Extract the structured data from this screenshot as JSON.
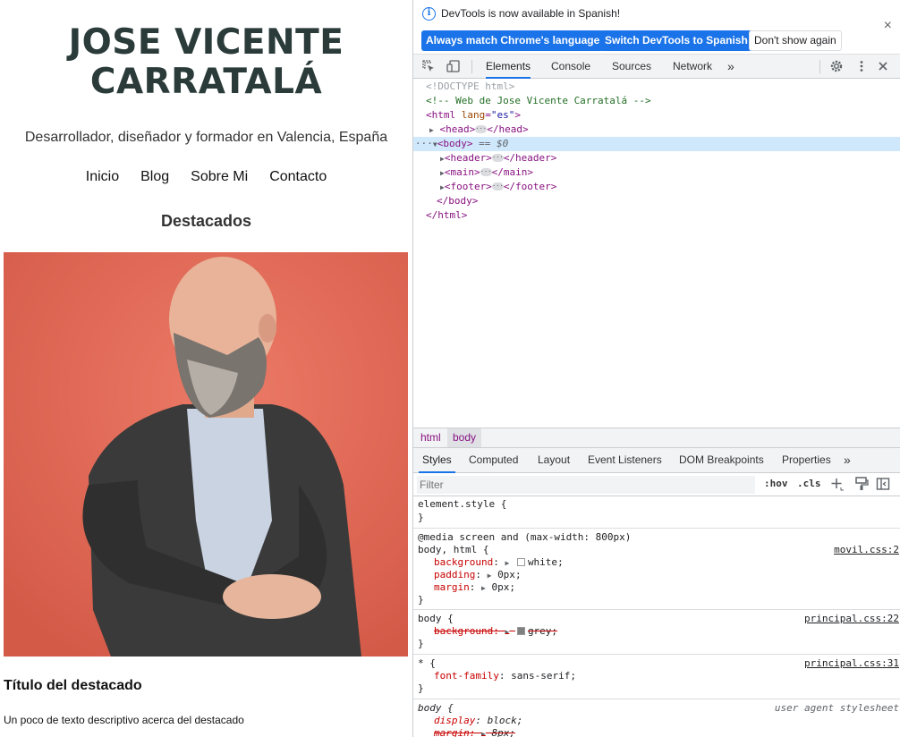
{
  "site": {
    "title_line1": "Jose Vicente",
    "title_line2": "Carratalá",
    "tagline": "Desarrollador, diseñador y formador en Valencia, España",
    "nav": [
      "Inicio",
      "Blog",
      "Sobre Mi",
      "Contacto"
    ],
    "featured_heading": "Destacados",
    "featured_title": "Título del destacado",
    "featured_text": "Un poco de texto descriptivo acerca del destacado"
  },
  "devtools": {
    "infobar": {
      "message": "DevTools is now available in Spanish!",
      "btn_match": "Always match Chrome's language",
      "btn_switch": "Switch DevTools to Spanish",
      "btn_dismiss": "Don't show again",
      "close_icon": "×"
    },
    "tabs": [
      "Elements",
      "Console",
      "Sources",
      "Network"
    ],
    "more_tabs": "»",
    "dom": {
      "doctype": "<!DOCTYPE html>",
      "comment": "<!-- Web de Jose Vicente Carratalá -->",
      "html_open_tag": "<html",
      "html_attr": "lang",
      "html_attr_value": "\"es\"",
      "html_close_bracket": ">",
      "head_open": "<head>",
      "head_close": "</head>",
      "body_open": "<body>",
      "selected_marker": "== $0",
      "header_open": "<header>",
      "header_close": "</header>",
      "main_open": "<main>",
      "main_close": "</main>",
      "footer_open": "<footer>",
      "footer_close": "</footer>",
      "body_close": "</body>",
      "html_close": "</html>"
    },
    "breadcrumbs": [
      "html",
      "body"
    ],
    "subtabs": [
      "Styles",
      "Computed",
      "Layout",
      "Event Listeners",
      "DOM Breakpoints",
      "Properties"
    ],
    "filter_placeholder": "Filter",
    "hov": ":hov",
    "cls": ".cls",
    "styles": {
      "element_style": "element.style {",
      "close": "}",
      "media": "@media screen and (max-width: 800px)",
      "rule1_selector": "body, html {",
      "rule1_source": "movil.css:2",
      "rule1_props": [
        {
          "name": "background",
          "value": "white",
          "swatch": "#ffffff"
        },
        {
          "name": "padding",
          "value": "0px"
        },
        {
          "name": "margin",
          "value": "0px"
        }
      ],
      "rule2_selector": "body {",
      "rule2_source": "principal.css:22",
      "rule2_prop_name": "background",
      "rule2_prop_value": "grey;",
      "rule2_swatch": "#808080",
      "rule3_selector": "* {",
      "rule3_source": "principal.css:31",
      "rule3_prop_name": "font-family",
      "rule3_prop_value": "sans-serif;",
      "rule4_selector": "body {",
      "rule4_source": "user agent stylesheet",
      "rule4_prop1_name": "display",
      "rule4_prop1_value": "block;",
      "rule4_prop2_name": "margin",
      "rule4_prop2_value": "8px;"
    }
  }
}
